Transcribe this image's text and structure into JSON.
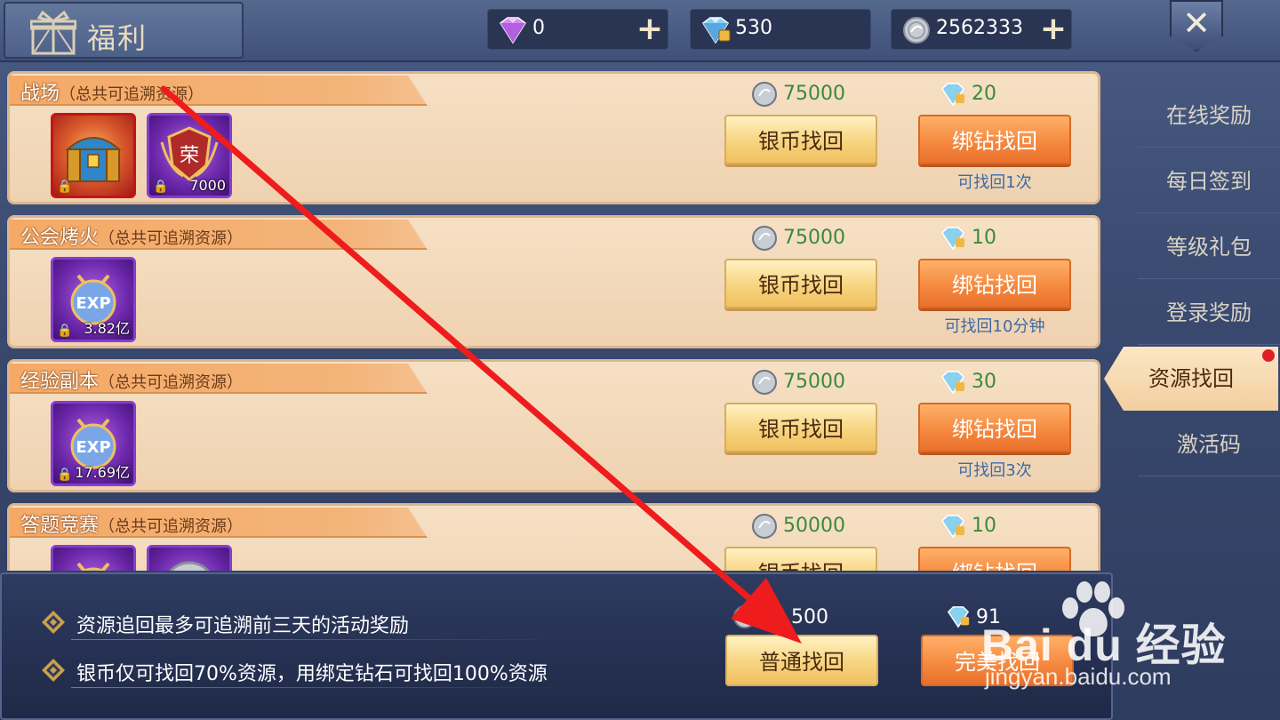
{
  "header": {
    "title": "福利",
    "currencies": [
      {
        "name": "diamond",
        "value": "0",
        "has_plus": true
      },
      {
        "name": "bound-diamond",
        "value": "530",
        "has_plus": false
      },
      {
        "name": "silver-coin",
        "value": "2562333",
        "has_plus": true
      }
    ],
    "plus": "+",
    "close": "✕"
  },
  "cards": [
    {
      "name": "战场",
      "note": "（总共可追溯资源）",
      "items": [
        {
          "icon": "treasure-chest-icon",
          "style": "red",
          "locked": true,
          "qty": ""
        },
        {
          "icon": "honor-badge-icon",
          "style": "purple",
          "locked": true,
          "qty": "7000",
          "glyph": "荣"
        }
      ],
      "silver_cost": "75000",
      "diamond_cost": "20",
      "silver_button": "银币找回",
      "diamond_button": "绑钻找回",
      "limit": "可找回1次"
    },
    {
      "name": "公会烤火",
      "note": "（总共可追溯资源）",
      "items": [
        {
          "icon": "exp-icon",
          "style": "purple",
          "locked": true,
          "qty": "3.82亿",
          "glyph": "EXP"
        }
      ],
      "silver_cost": "75000",
      "diamond_cost": "10",
      "silver_button": "银币找回",
      "diamond_button": "绑钻找回",
      "limit": "可找回10分钟"
    },
    {
      "name": "经验副本",
      "note": "（总共可追溯资源）",
      "items": [
        {
          "icon": "exp-icon",
          "style": "purple",
          "locked": true,
          "qty": "17.69亿",
          "glyph": "EXP"
        }
      ],
      "silver_cost": "75000",
      "diamond_cost": "30",
      "silver_button": "银币找回",
      "diamond_button": "绑钻找回",
      "limit": "可找回3次"
    },
    {
      "name": "答题竞赛",
      "note": "（总共可追溯资源）",
      "items": [
        {
          "icon": "exp-icon",
          "style": "purple",
          "locked": false,
          "qty": ""
        },
        {
          "icon": "silver-coin-icon",
          "style": "purple",
          "locked": false,
          "qty": ""
        }
      ],
      "silver_cost": "50000",
      "diamond_cost": "10",
      "silver_button": "银币找回",
      "diamond_button": "绑钻找回",
      "limit": ""
    }
  ],
  "sidenav": {
    "items": [
      "在线奖励",
      "每日签到",
      "等级礼包",
      "登录奖励",
      "资源找回",
      "激活码"
    ],
    "active": "资源找回"
  },
  "bottom": {
    "tips": [
      "资源追回最多可追溯前三天的活动奖励",
      "银币仅可找回70%资源，用绑定钻石可找回100%资源"
    ],
    "silver_total": "3???500",
    "silver_total_visible": "500",
    "diamond_total": "91",
    "normal_button": "普通找回",
    "perfect_button": "完美找回"
  },
  "watermark": {
    "brand": "Bai du 经验",
    "url": "jingyan.baidu.com"
  },
  "colors": {
    "card_bg": "#f6e0c4",
    "header_orange": "#f5a966",
    "cost_green": "#3a8a3a",
    "limit_blue": "#3c6aa8",
    "arrow_red": "#ee1c1c",
    "panel_navy": "#2e3b60"
  }
}
